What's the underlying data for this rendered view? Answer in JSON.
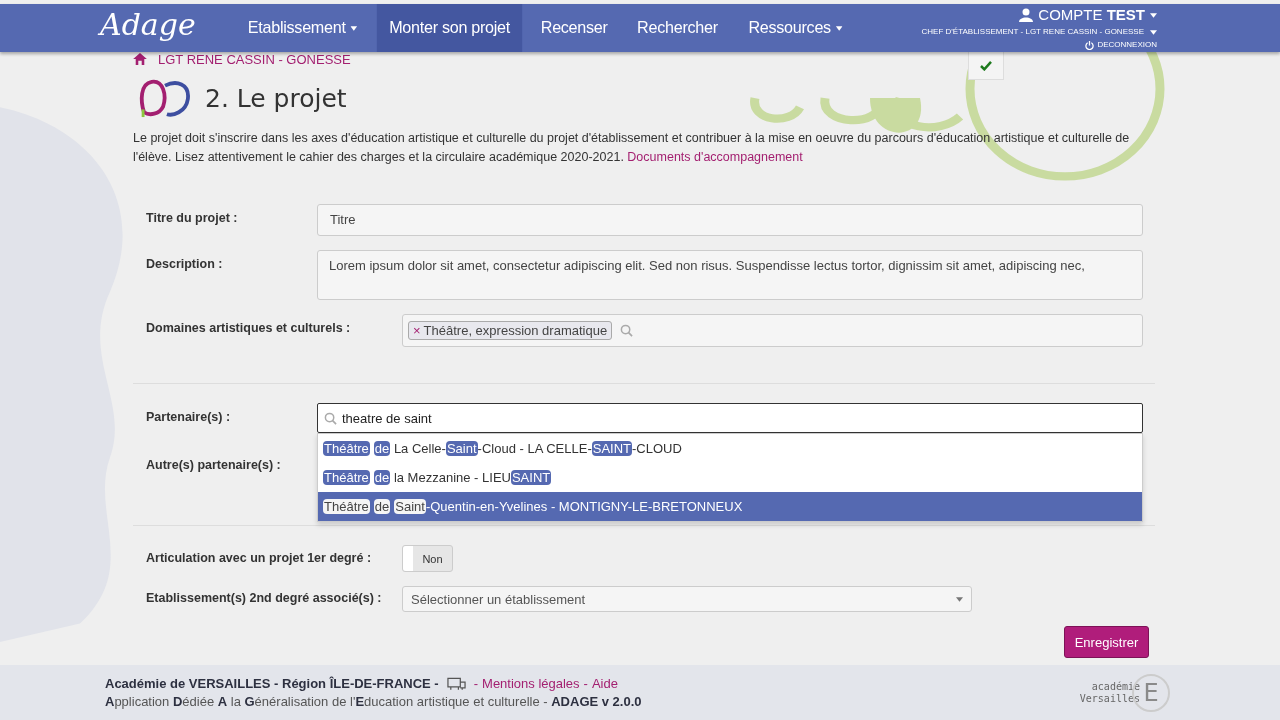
{
  "nav": {
    "logo": "Adage",
    "items": [
      {
        "label": "Etablissement",
        "dropdown": true,
        "selected": false
      },
      {
        "label": "Monter son projet",
        "dropdown": false,
        "selected": true
      },
      {
        "label": "Recenser",
        "dropdown": false,
        "selected": false
      },
      {
        "label": "Rechercher",
        "dropdown": false,
        "selected": false
      },
      {
        "label": "Ressources",
        "dropdown": true,
        "selected": false
      }
    ],
    "account": {
      "prefix": "COMPTE",
      "name": "TEST",
      "role": "CHEF D'ÉTABLISSEMENT - LGT RENE CASSIN - GONESSE",
      "logout": "DECONNEXION"
    }
  },
  "breadcrumb": "LGT RENE CASSIN - GONESSE",
  "page_title": "2. Le projet",
  "intro": {
    "text": "Le projet doit s'inscrire dans les axes d'éducation artistique et culturelle du projet d'établissement et contribuer à la mise en oeuvre du parcours d'éducation artistique et culturelle de l'élève. Lisez attentivement le cahier des charges et la circulaire académique 2020-2021.",
    "link": "Documents d'accompagnement"
  },
  "form": {
    "sections": [
      [
        {
          "kind": "text",
          "label": "Titre du projet :",
          "value": "Titre"
        },
        {
          "kind": "textarea",
          "label": "Description :",
          "value": "Lorem ipsum dolor sit amet, consectetur adipiscing elit. Sed non risus. Suspendisse lectus tortor, dignissim sit amet, adipiscing nec,"
        },
        {
          "kind": "tags",
          "label": "Domaines artistiques et culturels :",
          "tags": [
            {
              "remove": "×",
              "label": "Théâtre, expression dramatique"
            }
          ]
        }
      ],
      [
        {
          "kind": "search",
          "label": "Partenaire(s) :",
          "value": "theatre de saint",
          "suggestions": [
            {
              "selected": false,
              "parts": [
                {
                  "text": "Théâtre",
                  "match": true
                },
                {
                  "text": "de",
                  "match": true
                },
                {
                  "text": " La Celle-",
                  "match": false
                },
                {
                  "text": "Saint",
                  "match": true
                },
                {
                  "text": "-Cloud - LA CELLE-",
                  "match": false
                },
                {
                  "text": "SAINT",
                  "match": true
                },
                {
                  "text": "-CLOUD",
                  "match": false
                }
              ]
            },
            {
              "selected": false,
              "parts": [
                {
                  "text": "Théâtre",
                  "match": true
                },
                {
                  "text": "de",
                  "match": true
                },
                {
                  "text": " la Mezzanine - LIEU",
                  "match": false
                },
                {
                  "text": "SAINT",
                  "match": true
                }
              ]
            },
            {
              "selected": true,
              "parts": [
                {
                  "text": "Théâtre",
                  "match": true
                },
                {
                  "text": "de",
                  "match": true
                },
                {
                  "text": "Saint",
                  "match": true
                },
                {
                  "text": "-Quentin-en-Yvelines - MONTIGNY-LE-BRETONNEUX",
                  "match": false
                }
              ]
            }
          ]
        },
        {
          "kind": "covered",
          "label": "Autre(s) partenaire(s) :"
        }
      ],
      [
        {
          "kind": "toggle",
          "label": "Articulation avec un projet 1er degré :",
          "value": "Non",
          "on": false
        },
        {
          "kind": "select",
          "label": "Etablissement(s) 2nd degré associé(s) :",
          "placeholder": "Sélectionner un établissement"
        }
      ]
    ]
  },
  "save_button": "Enregistrer",
  "footer": {
    "line1": "Académie de VERSAILLES - Région ÎLE-DE-FRANCE -",
    "links": [
      {
        "separator": "-",
        "label": "Mentions légales"
      },
      {
        "separator": "-",
        "label": "Aide"
      }
    ],
    "line2": "**A**pplication **D**édiée **A** la **G**énéralisation de l'**E**ducation artistique et culturelle - **ADAGE v 2.0.0**",
    "logo_top": "académie",
    "logo_bottom": "Versailles",
    "logo_letter": "E"
  }
}
